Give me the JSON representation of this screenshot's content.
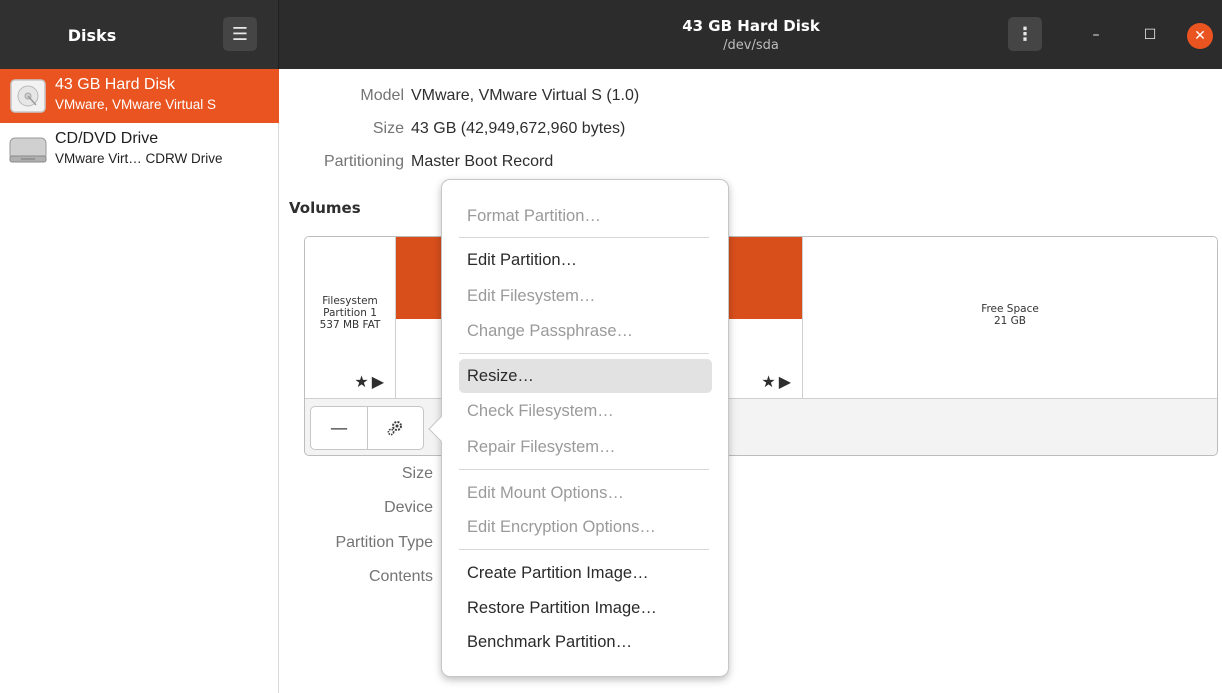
{
  "header": {
    "app_title": "Disks",
    "window_title": "43 GB Hard Disk",
    "window_subtitle": "/dev/sda",
    "close_label": "✕"
  },
  "sidebar": {
    "drives": [
      {
        "name": "43 GB Hard Disk",
        "subtitle": "VMware, VMware Virtual S",
        "selected": true,
        "icon": "hard-disk-icon"
      },
      {
        "name": "CD/DVD Drive",
        "subtitle": "VMware Virt… CDRW Drive",
        "selected": false,
        "icon": "optical-drive-icon"
      }
    ]
  },
  "disk_info": {
    "model_label": "Model",
    "model_value": "VMware, VMware Virtual S (1.0)",
    "size_label": "Size",
    "size_value": "43 GB (42,949,672,960 bytes)",
    "partitioning_label": "Partitioning",
    "partitioning_value": "Master Boot Record"
  },
  "volumes": {
    "heading": "Volumes",
    "partitions": [
      {
        "line1": "Filesystem",
        "line2": "Partition 1",
        "line3": "537 MB FAT",
        "icons": "★▶"
      },
      {
        "line1": "",
        "line2": "",
        "line3": "",
        "icons": "★▶",
        "selected": true
      },
      {
        "line1": "Free Space",
        "line2": "21 GB",
        "line3": ""
      }
    ],
    "tools": {
      "remove_icon": "minus-icon",
      "settings_icon": "gears-icon"
    }
  },
  "partition_info": {
    "size_label": "Size",
    "device_label": "Device",
    "partition_type_label": "Partition Type",
    "contents_label": "Contents"
  },
  "context_menu": {
    "items": [
      {
        "label": "Format Partition…",
        "enabled": false
      },
      {
        "label": "Edit Partition…",
        "enabled": true
      },
      {
        "label": "Edit Filesystem…",
        "enabled": false
      },
      {
        "label": "Change Passphrase…",
        "enabled": false
      },
      {
        "label": "Resize…",
        "enabled": true,
        "highlighted": true
      },
      {
        "label": "Check Filesystem…",
        "enabled": false
      },
      {
        "label": "Repair Filesystem…",
        "enabled": false
      },
      {
        "label": "Edit Mount Options…",
        "enabled": false
      },
      {
        "label": "Edit Encryption Options…",
        "enabled": false
      },
      {
        "label": "Create Partition Image…",
        "enabled": true
      },
      {
        "label": "Restore Partition Image…",
        "enabled": true
      },
      {
        "label": "Benchmark Partition…",
        "enabled": true
      }
    ]
  },
  "colors": {
    "accent": "#e95420",
    "partition_used": "#d84f1c",
    "header_bg": "#2c2c2c"
  }
}
